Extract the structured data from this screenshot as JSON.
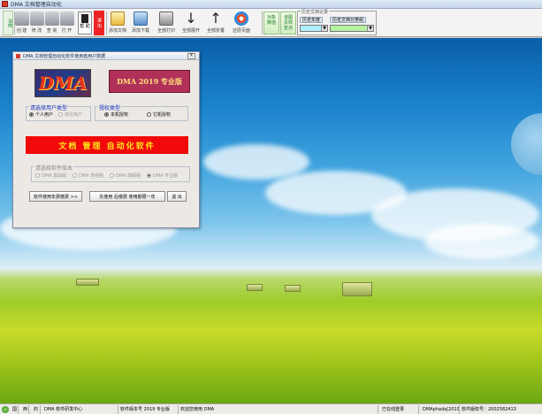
{
  "window": {
    "title": "DMA 文档管理自动化"
  },
  "toolbar": {
    "v1": "当前",
    "b1": "创 建",
    "b2": "修 改",
    "b3": "查 询",
    "b4": "打 开",
    "b5": "帮 助",
    "b6": "退 出",
    "b7": "添加文档",
    "b8": "添加下载",
    "b9": "全部打印",
    "b10": "全部展开",
    "b11": "全部折叠",
    "b12": "还原页面",
    "g1": "对象 数值",
    "g2": "该图 页样 宏点",
    "hist_caption": "历史文档记录",
    "hist_year_label": "历史年度",
    "hist_cat_label": "历史文档分类组",
    "hist_year_value": "",
    "hist_cat_value": ""
  },
  "dialog": {
    "title": "DMA 文档管理自动化软件使用者用户数据",
    "close": "X",
    "logo": "DMA",
    "version": "DMA 2019 专业版",
    "user_type": {
      "caption": "请选择用户类型",
      "opt1": "个人用户",
      "opt2": "单位用户"
    },
    "auth": {
      "caption": "授权类型",
      "opt1": "本机授权",
      "opt2": "它机授权"
    },
    "banner": "文档  管理  自动化软件",
    "edition": {
      "caption": "请选择软件版本",
      "opt1": "DMA 基础版",
      "opt2": "DMA 增强版",
      "opt3": "DMA 旗舰版",
      "opt4": "DMA 专业版"
    },
    "btn1": "软件使用年费缴费 >>",
    "btn2": "先使用 后缴费 使用期限一年",
    "btn3": "退 出"
  },
  "statusbar": {
    "c1": "国",
    "c2": "西",
    "c3": "的",
    "c4": "DMA 软件研发中心",
    "c5": "软件版本号 2019 专业版",
    "c6": "欢迎您使用 DMA",
    "c7": "已在线登录",
    "c8": "DMAphada[2019]",
    "c9": "软件版权号：2002582413"
  },
  "colors": {
    "banner_bg": "#f20a0a",
    "banner_fg": "#ffe21a",
    "version_bg": "#b0305a"
  }
}
